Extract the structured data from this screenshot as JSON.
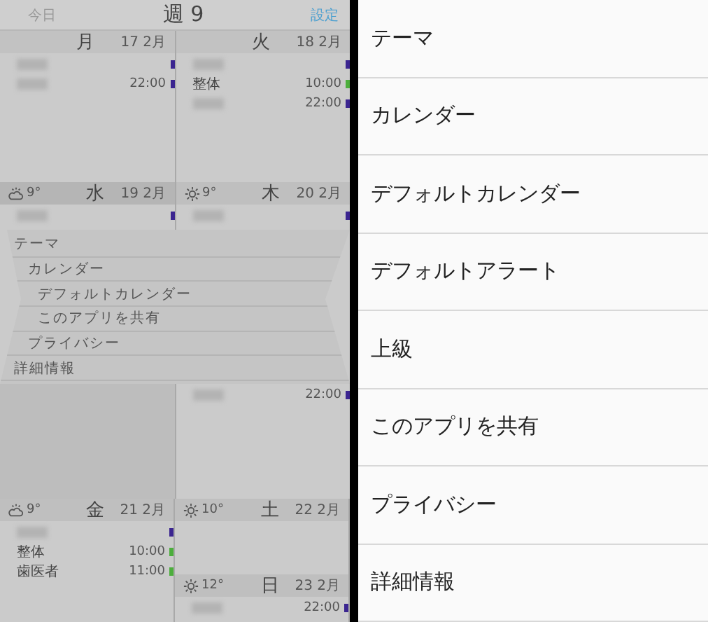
{
  "header": {
    "today": "今日",
    "title": "週 9",
    "settings": "設定"
  },
  "days": [
    {
      "name": "月",
      "date": "17 2月",
      "events": [
        {
          "color": "#3b2590"
        },
        {
          "time": "22:00",
          "color": "#3b2590"
        }
      ]
    },
    {
      "name": "火",
      "date": "18 2月",
      "events": [
        {
          "color": "#3b2590"
        },
        {
          "title": "整体",
          "time": "10:00",
          "color": "#4cae3c"
        },
        {
          "time": "22:00",
          "color": "#3b2590"
        }
      ]
    },
    {
      "name": "水",
      "date": "19 2月",
      "weather": {
        "kind": "cloud-sun",
        "temp": "9°"
      },
      "events": [
        {
          "color": "#3b2590"
        }
      ]
    },
    {
      "name": "木",
      "date": "20 2月",
      "weather": {
        "kind": "sun",
        "temp": "9°"
      },
      "events": [
        {
          "color": "#3b2590"
        },
        {
          "time": "22:00",
          "color": "#3b2590"
        }
      ]
    },
    {
      "name": "金",
      "date": "21 2月",
      "weather": {
        "kind": "cloud-sun",
        "temp": "9°"
      },
      "events": [
        {
          "color": "#3b2590"
        },
        {
          "title": "整体",
          "time": "10:00",
          "color": "#4cae3c"
        },
        {
          "title": "歯医者",
          "time": "11:00",
          "color": "#4cae3c"
        }
      ]
    },
    {
      "name": "土",
      "date": "22 2月",
      "weather": {
        "kind": "sun",
        "temp": "10°"
      }
    },
    {
      "name": "日",
      "date": "23 2月",
      "weather": {
        "kind": "sun",
        "temp": "12°"
      },
      "events": [
        {
          "time": "22:00",
          "color": "#3b2590"
        }
      ]
    }
  ],
  "folded_menu": [
    "テーマ",
    "カレンダー",
    "デフォルトカレンダー",
    "このアプリを共有",
    "プライバシー",
    "詳細情報"
  ],
  "settings_list": [
    "テーマ",
    "カレンダー",
    "デフォルトカレンダー",
    "デフォルトアラート",
    "上級",
    "このアプリを共有",
    "プライバシー",
    "詳細情報"
  ]
}
